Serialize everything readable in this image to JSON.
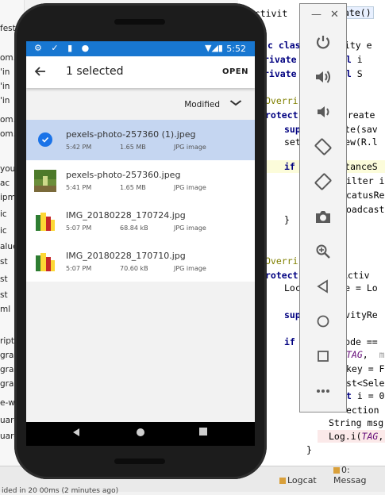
{
  "ide": {
    "sidebar_lines": [
      "fests",
      "om.",
      "'in",
      "'in",
      "'in",
      "om.",
      "om.",
      "you",
      "ac",
      "ipm",
      "ic",
      "ic",
      "alue",
      "st",
      "st",
      "st",
      "ml",
      "ript",
      "gra",
      "gra",
      "gra",
      "e-w",
      "uard",
      "uard"
    ],
    "code_line_1": "inActivit",
    "code_line_1b": "ate()",
    "status_tabs": [
      "Logcat",
      "0: Messag"
    ],
    "status_text": "ided in 20 00ms (2 minutes ago)"
  },
  "emulator": {
    "minimize": "—",
    "close": "✕",
    "buttons": [
      "power-icon",
      "volume-up-icon",
      "volume-down-icon",
      "rotate-left-icon",
      "rotate-right-icon",
      "camera-icon",
      "zoom-icon",
      "back-icon",
      "home-icon",
      "overview-icon",
      "more-icon"
    ]
  },
  "status_bar": {
    "time": "5:52",
    "left_icons": "⚙ ✓ ▮ ●",
    "right_icons": "▼◢▮"
  },
  "app_bar": {
    "title": "1 selected",
    "open_label": "OPEN"
  },
  "sort": {
    "label": "Modified"
  },
  "files": [
    {
      "name": "pexels-photo-257360 (1).jpeg",
      "date": "5:42 PM",
      "size": "1.65 MB",
      "type": "JPG image",
      "selected": true
    },
    {
      "name": "pexels-photo-257360.jpeg",
      "date": "5:41 PM",
      "size": "1.65 MB",
      "type": "JPG image",
      "selected": false
    },
    {
      "name": "IMG_20180228_170724.jpg",
      "date": "5:07 PM",
      "size": "68.84 kB",
      "type": "JPG image",
      "selected": false
    },
    {
      "name": "IMG_20180228_170710.jpg",
      "date": "5:07 PM",
      "size": "70.60 kB",
      "type": "JPG image",
      "selected": false
    }
  ],
  "colors": {
    "status_bar": "#1877d1",
    "selected_row": "#c5d6f1",
    "check_accent": "#1a73e8"
  }
}
